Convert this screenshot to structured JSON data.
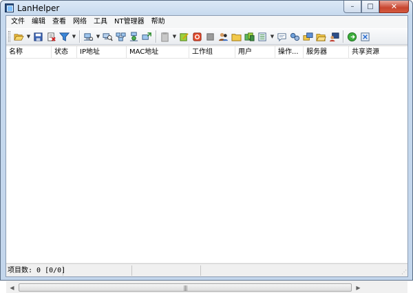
{
  "window": {
    "title": "LanHelper",
    "minimize_glyph": "–",
    "maximize_glyph": "□",
    "close_glyph": "✕"
  },
  "menu": [
    {
      "label": "文件"
    },
    {
      "label": "编辑"
    },
    {
      "label": "查看"
    },
    {
      "label": "网络"
    },
    {
      "label": "工具"
    },
    {
      "label": "NT管理器"
    },
    {
      "label": "帮助"
    }
  ],
  "toolbar": {
    "icons": [
      "open-folder-icon",
      "save-icon",
      "delete-list-icon",
      "filter-icon",
      "scan-network-icon",
      "computer-search-icon",
      "computers-icon",
      "network-neighbors-icon",
      "send-computer-icon",
      "clipboard-icon",
      "edit-note-icon",
      "stop-icon",
      "grey-box-icon",
      "users-icon",
      "folder-icon",
      "colors-icon",
      "list-view-icon",
      "message-icon",
      "network-link-icon",
      "share-icon",
      "open-share-icon",
      "user-computer-icon",
      "power-icon",
      "exit-icon"
    ]
  },
  "columns": [
    {
      "label": "名称"
    },
    {
      "label": "状态"
    },
    {
      "label": "IP地址"
    },
    {
      "label": "MAC地址"
    },
    {
      "label": "工作组"
    },
    {
      "label": "用户"
    },
    {
      "label": "操作..."
    },
    {
      "label": "服务器"
    },
    {
      "label": "共享资源"
    }
  ],
  "statusbar": {
    "item_count": "项目数: 0 [0/0]"
  },
  "colors": {
    "accent": "#3a86d8",
    "close": "#c8452f"
  }
}
